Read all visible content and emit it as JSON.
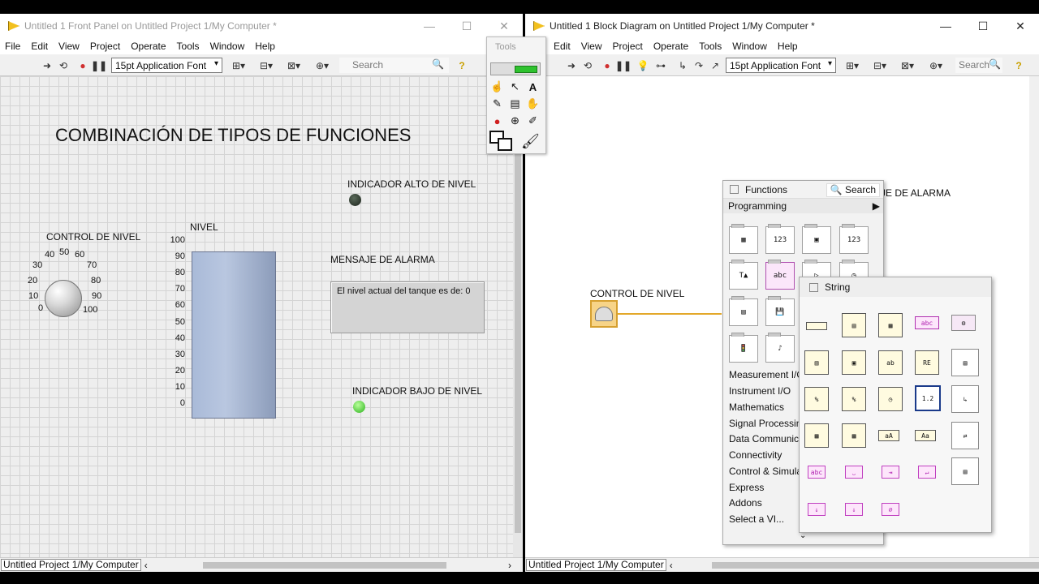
{
  "front_panel": {
    "title": "Untitled 1 Front Panel on Untitled Project 1/My Computer *",
    "menu": [
      "File",
      "Edit",
      "View",
      "Project",
      "Operate",
      "Tools",
      "Window",
      "Help"
    ],
    "font_select": "15pt Application Font",
    "search_placeholder": "Search",
    "heading": "COMBINACIÓN DE TIPOS DE FUNCIONES",
    "knob": {
      "label": "CONTROL DE NIVEL",
      "ticks": [
        "0",
        "10",
        "20",
        "30",
        "40",
        "50",
        "60",
        "70",
        "80",
        "90",
        "100"
      ]
    },
    "tank": {
      "label": "NIVEL",
      "scale": [
        "100",
        "90",
        "80",
        "70",
        "60",
        "50",
        "40",
        "30",
        "20",
        "10",
        "0"
      ]
    },
    "led_high": {
      "label": "INDICADOR ALTO DE NIVEL",
      "color": "#2d3a2d"
    },
    "led_low": {
      "label": "INDICADOR BAJO DE NIVEL",
      "color": "#3fd22e"
    },
    "string_indicator": {
      "label": "MENSAJE DE ALARMA",
      "value": "El nivel actual del tanque es de: 0"
    },
    "status_project": "Untitled Project 1/My Computer"
  },
  "tools_palette": {
    "title": "Tools"
  },
  "block_diagram": {
    "title": "Untitled 1 Block Diagram on Untitled Project 1/My Computer *",
    "menu": [
      "Edit",
      "View",
      "Project",
      "Operate",
      "Tools",
      "Window",
      "Help"
    ],
    "font_select": "15pt Application Font",
    "search_placeholder": "Search",
    "control_label": "CONTROL DE NIVEL",
    "partial_label": "JE DE ALARMA",
    "status_project": "Untitled Project 1/My Computer"
  },
  "functions_palette": {
    "title": "Functions",
    "search_label": "Search",
    "section": "Programming",
    "categories": [
      "Measurement I/O",
      "Instrument I/O",
      "Mathematics",
      "Signal Processing",
      "Data Communica",
      "Connectivity",
      "Control & Simula",
      "Express",
      "Addons",
      "Select a VI..."
    ]
  },
  "string_palette": {
    "title": "String"
  }
}
